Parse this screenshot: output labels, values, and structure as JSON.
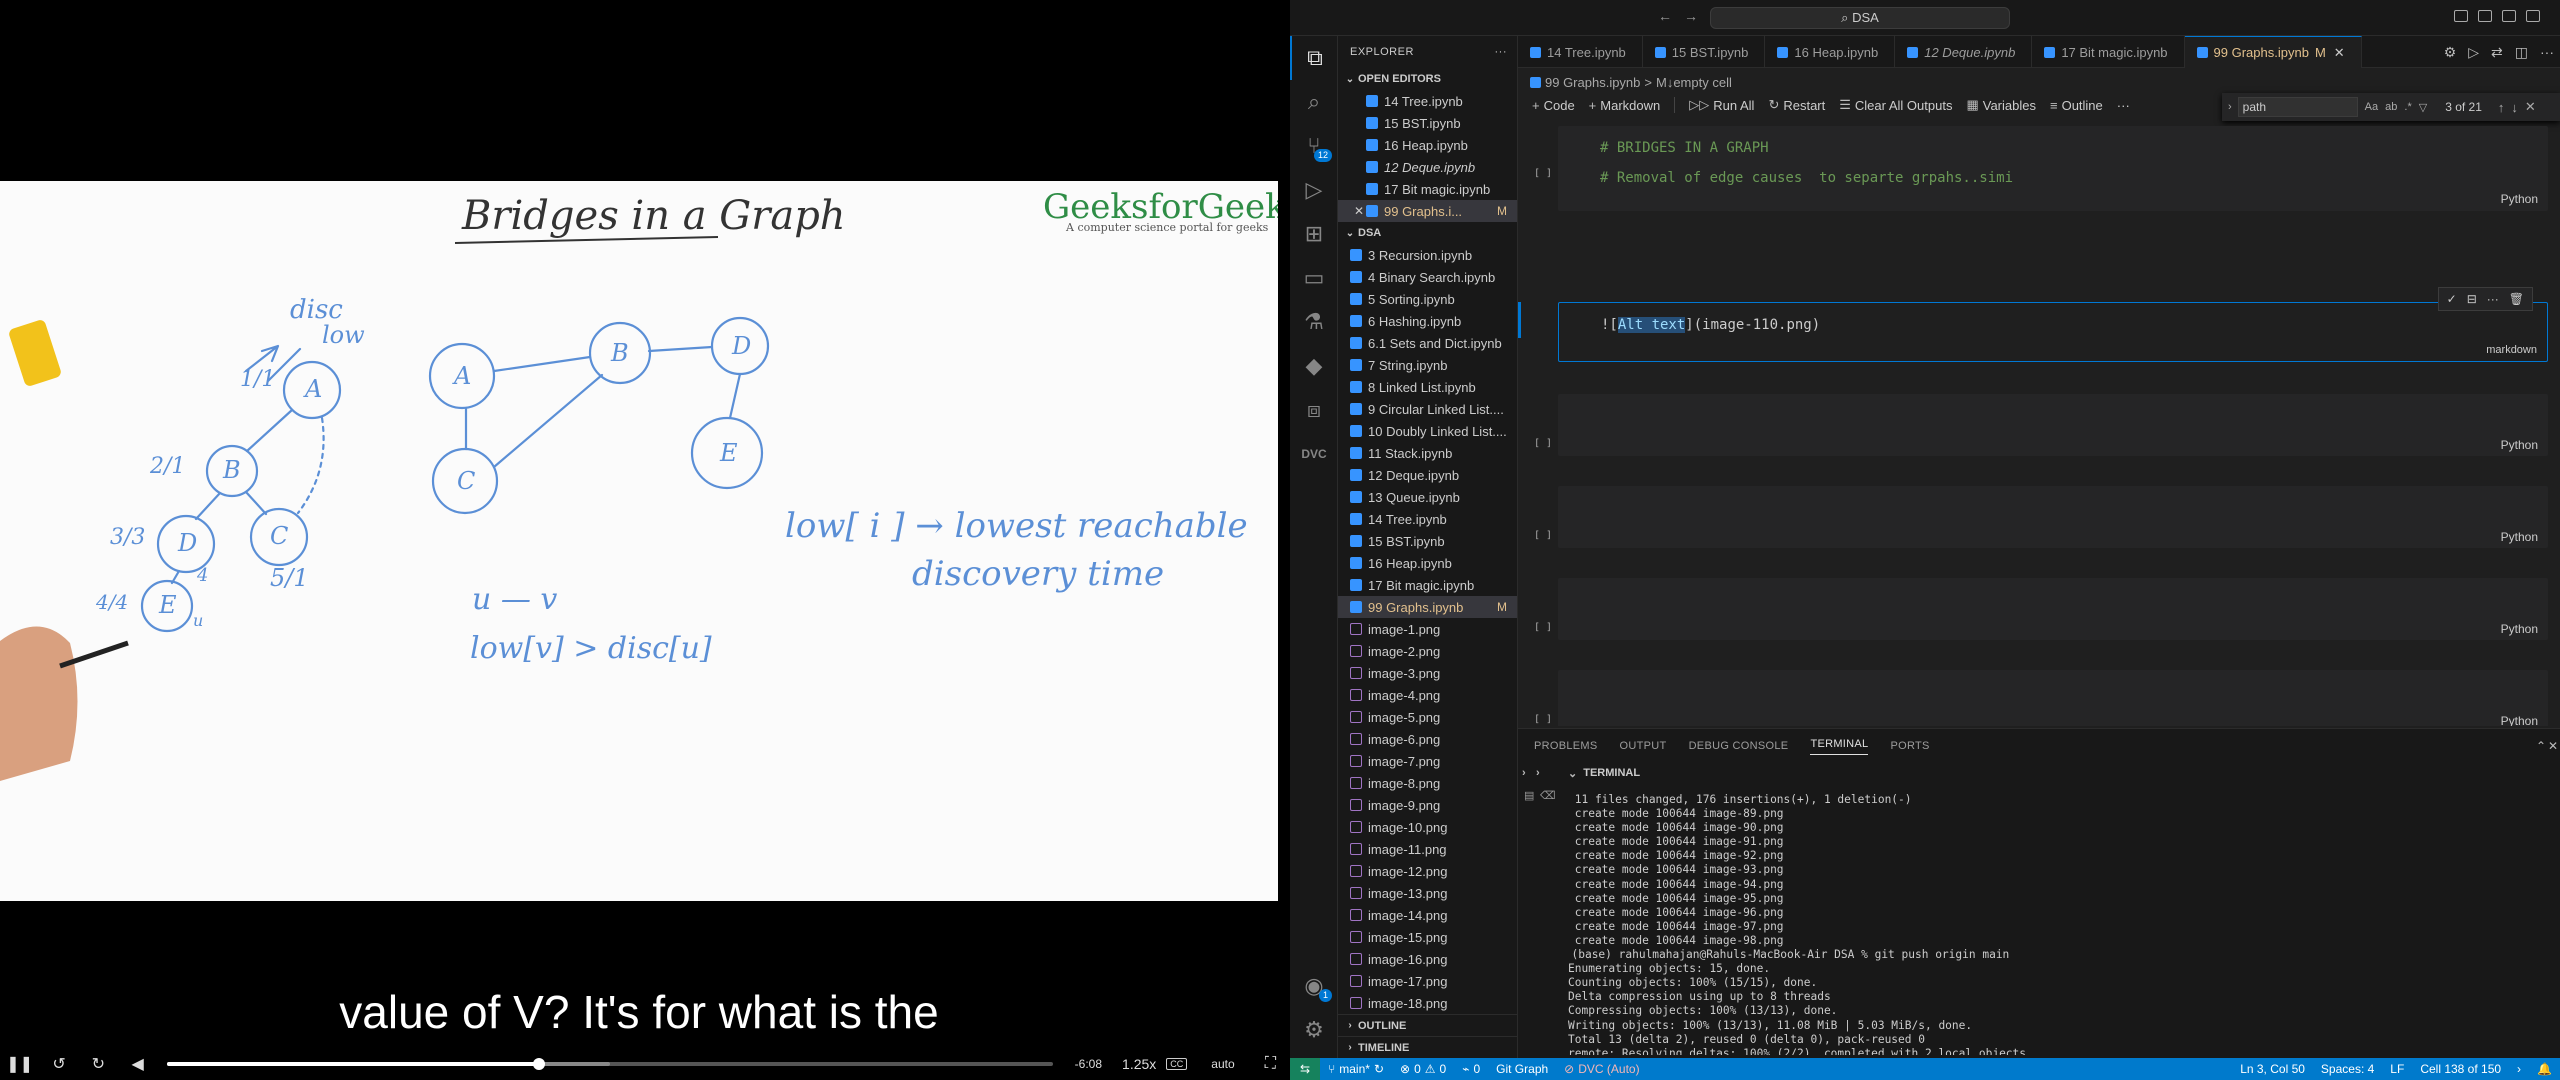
{
  "video": {
    "whiteboard": {
      "title": "Bridges in a Graph",
      "brand": "GeeksforGeeks",
      "brand_tagline": "A computer science portal for geeks",
      "notes": {
        "disc": "disc",
        "low": "low",
        "a_ratio": "1/1",
        "b_ratio": "2/1",
        "d_ratio": "3/3",
        "e_ratio": "4/4",
        "c_ratio": "5/1",
        "d_note": "4",
        "e_note": "u",
        "edge": "u — v",
        "condition": "low[v] > disc[u]",
        "def_line1": "low[ i ] → lowest reachable",
        "def_line2": "discovery time"
      },
      "nodes": [
        "A",
        "B",
        "C",
        "D",
        "E"
      ]
    },
    "subtitle": "value of V? It's for what is the",
    "controls": {
      "play_icon": "pause-icon",
      "time_left": "-6:08",
      "speed": "1.25x",
      "cc": "CC",
      "quality": "auto",
      "progress": 0.42,
      "buffered": 0.5
    }
  },
  "vscode": {
    "titlebar": {
      "search_text": "DSA"
    },
    "sidebar": {
      "title": "EXPLORER",
      "open_editors_title": "OPEN EDITORS",
      "open_editors": [
        {
          "label": "14 Tree.ipynb",
          "italic": false
        },
        {
          "label": "15 BST.ipynb",
          "italic": false
        },
        {
          "label": "16 Heap.ipynb",
          "italic": false
        },
        {
          "label": "12 Deque.ipynb",
          "italic": true
        },
        {
          "label": "17 Bit magic.ipynb",
          "italic": false
        },
        {
          "label": "99 Graphs.i...",
          "italic": false,
          "modified": "M",
          "active": true
        }
      ],
      "folder_title": "DSA",
      "files": [
        "3 Recursion.ipynb",
        "4 Binary Search.ipynb",
        "5 Sorting.ipynb",
        "6 Hashing.ipynb",
        "6.1 Sets and Dict.ipynb",
        "7 String.ipynb",
        "8 Linked List.ipynb",
        "9 Circular Linked List....",
        "10 Doubly Linked List....",
        "11 Stack.ipynb",
        "12 Deque.ipynb",
        "13 Queue.ipynb",
        "14 Tree.ipynb",
        "15 BST.ipynb",
        "16 Heap.ipynb",
        "17 Bit magic.ipynb",
        "99 Graphs.ipynb",
        "image-1.png",
        "image-2.png",
        "image-3.png",
        "image-4.png",
        "image-5.png",
        "image-6.png",
        "image-7.png",
        "image-8.png",
        "image-9.png",
        "image-10.png",
        "image-11.png",
        "image-12.png",
        "image-13.png",
        "image-14.png",
        "image-15.png",
        "image-16.png",
        "image-17.png",
        "image-18.png"
      ],
      "modified_file": "99 Graphs.ipynb",
      "modified_mark": "M",
      "outline_title": "OUTLINE",
      "timeline_title": "TIMELINE"
    },
    "tabs": [
      {
        "label": "14 Tree.ipynb"
      },
      {
        "label": "15 BST.ipynb"
      },
      {
        "label": "16 Heap.ipynb"
      },
      {
        "label": "12 Deque.ipynb"
      },
      {
        "label": "17 Bit magic.ipynb"
      },
      {
        "label": "99 Graphs.ipynb",
        "active": true,
        "mark": "M"
      }
    ],
    "breadcrumb": {
      "file": "99 Graphs.ipynb",
      "sep": ">",
      "cell": "M↓empty cell"
    },
    "notebook_toolbar": {
      "code": "Code",
      "markdown": "Markdown",
      "run_all": "Run All",
      "restart": "Restart",
      "clear_outputs": "Clear All Outputs",
      "variables": "Variables",
      "outline": "Outline",
      "more": "···"
    },
    "find": {
      "query": "path",
      "result": "3 of 21"
    },
    "cells": {
      "cell1_line1": "# BRIDGES IN A GRAPH",
      "cell1_line2": "# Removal of edge causes  to separte grpahs..simi",
      "md_prefix": "![",
      "md_selected": "Alt text",
      "md_suffix": "](image-110.png)",
      "md_lang": "markdown",
      "python": "Python",
      "bracket": "[ ]"
    },
    "panel": {
      "tabs": [
        "PROBLEMS",
        "OUTPUT",
        "DEBUG CONSOLE",
        "TERMINAL",
        "PORTS"
      ],
      "terminal_title": "TERMINAL",
      "lines": [
        " 11 files changed, 176 insertions(+), 1 deletion(-)",
        " create mode 100644 image-89.png",
        " create mode 100644 image-90.png",
        " create mode 100644 image-91.png",
        " create mode 100644 image-92.png",
        " create mode 100644 image-93.png",
        " create mode 100644 image-94.png",
        " create mode 100644 image-95.png",
        " create mode 100644 image-96.png",
        " create mode 100644 image-97.png",
        " create mode 100644 image-98.png",
        "(base) rahulmahajan@Rahuls-MacBook-Air DSA % git push origin main",
        "Enumerating objects: 15, done.",
        "Counting objects: 100% (15/15), done.",
        "Delta compression using up to 8 threads",
        "Compressing objects: 100% (13/13), done.",
        "Writing objects: 100% (13/13), 11.08 MiB | 5.03 MiB/s, done.",
        "Total 13 (delta 2), reused 0 (delta 0), pack-reused 0",
        "remote: Resolving deltas: 100% (2/2), completed with 2 local objects."
      ]
    },
    "statusbar": {
      "branch": "main*",
      "errors": "0",
      "warnings": "0",
      "ports": "0",
      "git_graph": "Git Graph",
      "dvc": "DVC (Auto)",
      "position": "Ln 3, Col 50",
      "spaces": "Spaces: 4",
      "eol": "LF",
      "cell": "Cell 138 of 150"
    },
    "badges": {
      "scm": "12",
      "accounts": "1"
    }
  }
}
